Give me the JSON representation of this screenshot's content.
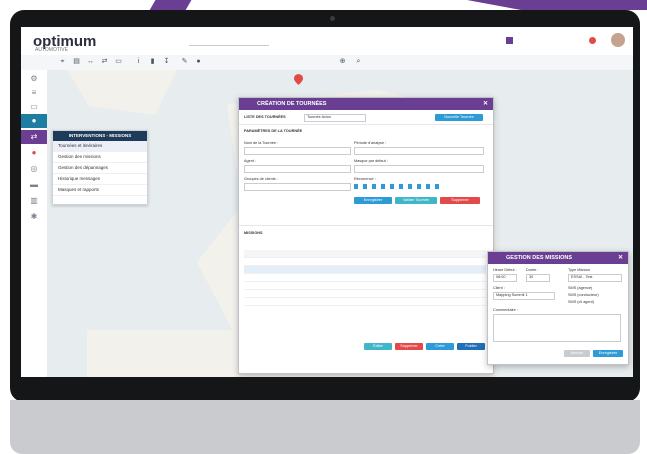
{
  "app": {
    "logo": "optimum",
    "logo_sub": "AUTOMOTIVE"
  },
  "sidebar_menu": {
    "title": "INTERVENTIONS - MISSIONS",
    "items": [
      "Tournées et itinéraires",
      "Gestion des missions",
      "Gestion des dépannages",
      "Historique messages",
      "Masques et rapports"
    ]
  },
  "dialog_tournees": {
    "title": "CRÉATION DE TOURNÉES",
    "list_label": "LISTE DES TOURNÉES",
    "list_select": "Tournée Avion",
    "new_button": "Nouvelle Tournée",
    "params_label": "PARAMÈTRES DE LA TOURNÉE",
    "name_label": "Nom de la Tournée :",
    "period_label": "Période d'analyse :",
    "agent_label": "Agent :",
    "mask_label": "Masque par défaut :",
    "group_label": "Groupes de clients :",
    "recurrence_label": "Récurrence :",
    "save_button": "Enregistrer",
    "validate_button": "Valider Tournée",
    "delete_button": "Supprimer",
    "missions_label": "MISSIONS",
    "footer_buttons": [
      "Éditer",
      "Supprimer",
      "Créer",
      "Publier"
    ]
  },
  "dialog_missions": {
    "title": "GESTION DES MISSIONS",
    "start_label": "Heure Début :",
    "start_value": "08:00",
    "duration_label": "Durée :",
    "duration_value": "30",
    "type_label": "Type Mission",
    "type_value": "ESSAI - Test",
    "client_label": "Client :",
    "client_value": "Mapping Summit 1",
    "options": [
      "SMS (agence)",
      "SMS (conducteur)",
      "SMS (cli agent)"
    ],
    "comment_label": "Commentaire :",
    "cancel_button": "Annuler",
    "save_button": "Enregistrer"
  },
  "colors": {
    "brand": "#6a3f93",
    "accent": "#1e7ea1",
    "red": "#e24a4a",
    "blue": "#2d9bd6"
  }
}
